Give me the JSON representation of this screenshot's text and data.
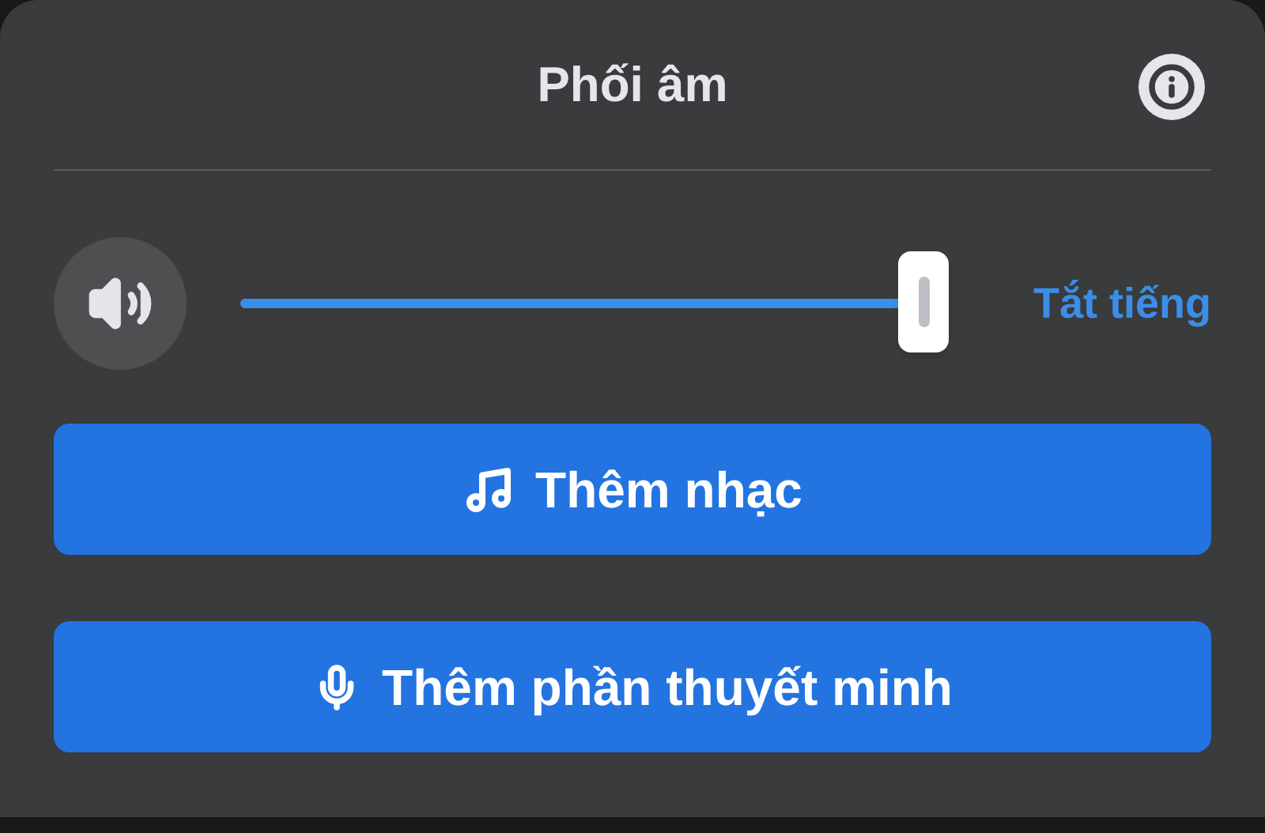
{
  "header": {
    "title": "Phối âm"
  },
  "volume": {
    "level": 1,
    "mute_label": "Tắt tiếng"
  },
  "buttons": [
    {
      "label": "Thêm nhạc",
      "kind": "music"
    },
    {
      "label": "Thêm phần thuyết minh",
      "kind": "voice"
    }
  ]
}
